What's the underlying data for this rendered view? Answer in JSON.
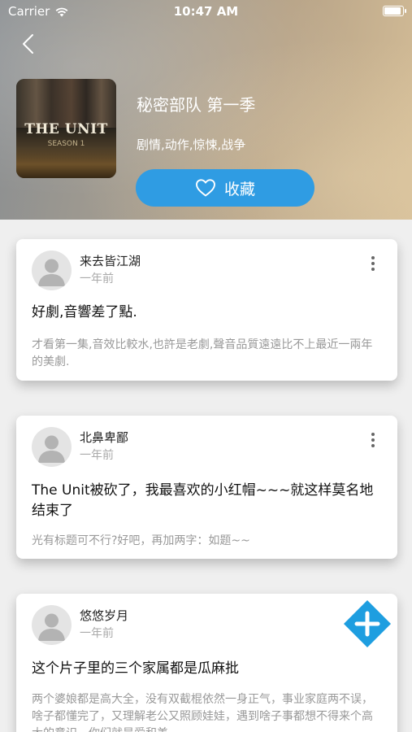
{
  "status": {
    "carrier": "Carrier",
    "time": "10:47 AM"
  },
  "show": {
    "poster_title": "THE UNIT",
    "poster_subtitle": "SEASON 1",
    "title": "秘密部队 第一季",
    "genres": "剧情,动作,惊悚,战争",
    "favorite_label": "收藏"
  },
  "comments": [
    {
      "user": "来去皆江湖",
      "time": "一年前",
      "title": "好劇,音響差了點.",
      "body": "才看第一集,音效比較水,也許是老劇,聲音品質遠遠比不上最近一兩年的美劇."
    },
    {
      "user": "北鼻卑鄙",
      "time": "一年前",
      "title": "The Unit被砍了，我最喜欢的小红帽~~~就这样莫名地结束了",
      "body": "光有标题可不行?好吧，再加两字：如题~~"
    },
    {
      "user": "悠悠岁月",
      "time": "一年前",
      "title": "这个片子里的三个家属都是瓜麻批",
      "body": "两个婆娘都是高大全，没有双截棍依然一身正气，事业家庭两不误，啥子都懂完了，又理解老公又照顾娃娃，遇到啥子事都想不得来个高大的意识，你们就是爱和美…"
    }
  ],
  "colors": {
    "accent": "#2f9ce3",
    "fab": "#1e9ee0"
  }
}
